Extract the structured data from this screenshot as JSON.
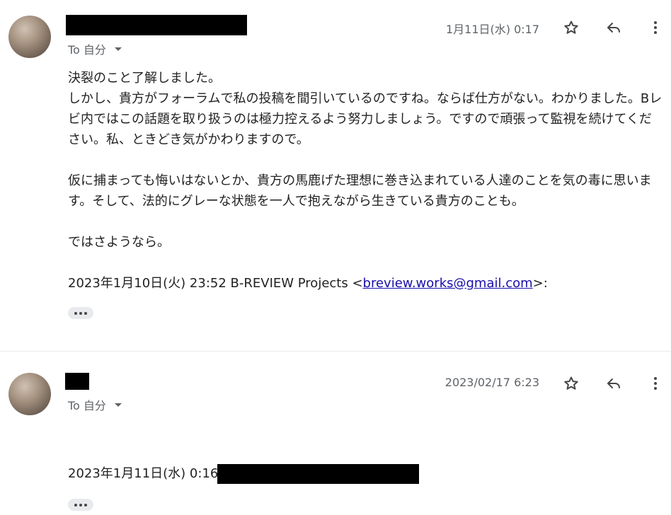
{
  "messages": [
    {
      "to_label": "To 自分",
      "date": "1月11日(水) 0:17",
      "body": [
        "決裂のこと了解しました。",
        "しかし、貴方がフォーラムで私の投稿を間引いているのですね。ならば仕方がない。わかりました。Bレビ内ではこの話題を取り扱うのは極力控えるよう努力しましょう。ですので頑張って監視を続けてください。私、ときどき気がかわりますので。",
        "仮に捕まっても悔いはないとか、貴方の馬鹿げた理想に巻き込まれている人達のことを気の毒に思います。そして、法的にグレーな状態を一人で抱えながら生きている貴方のことも。",
        "ではさようなら。"
      ],
      "quote_prefix": "2023年1月10日(火) 23:52 B-REVIEW Projects <",
      "quote_email": "breview.works@gmail.com",
      "quote_suffix": ">:"
    },
    {
      "to_label": "To 自分",
      "date": "2023/02/17 6:23",
      "quote_prefix": "2023年1月11日(水) 0:16"
    }
  ],
  "icons": {
    "star": "star-icon",
    "reply": "reply-icon",
    "more": "more-vert-icon",
    "caret": "caret-down-icon",
    "ellipsis": "ellipsis-icon"
  },
  "colors": {
    "link": "#1a0dab",
    "muted": "#5f6368",
    "text": "#222222",
    "divider": "#e8eaed"
  }
}
